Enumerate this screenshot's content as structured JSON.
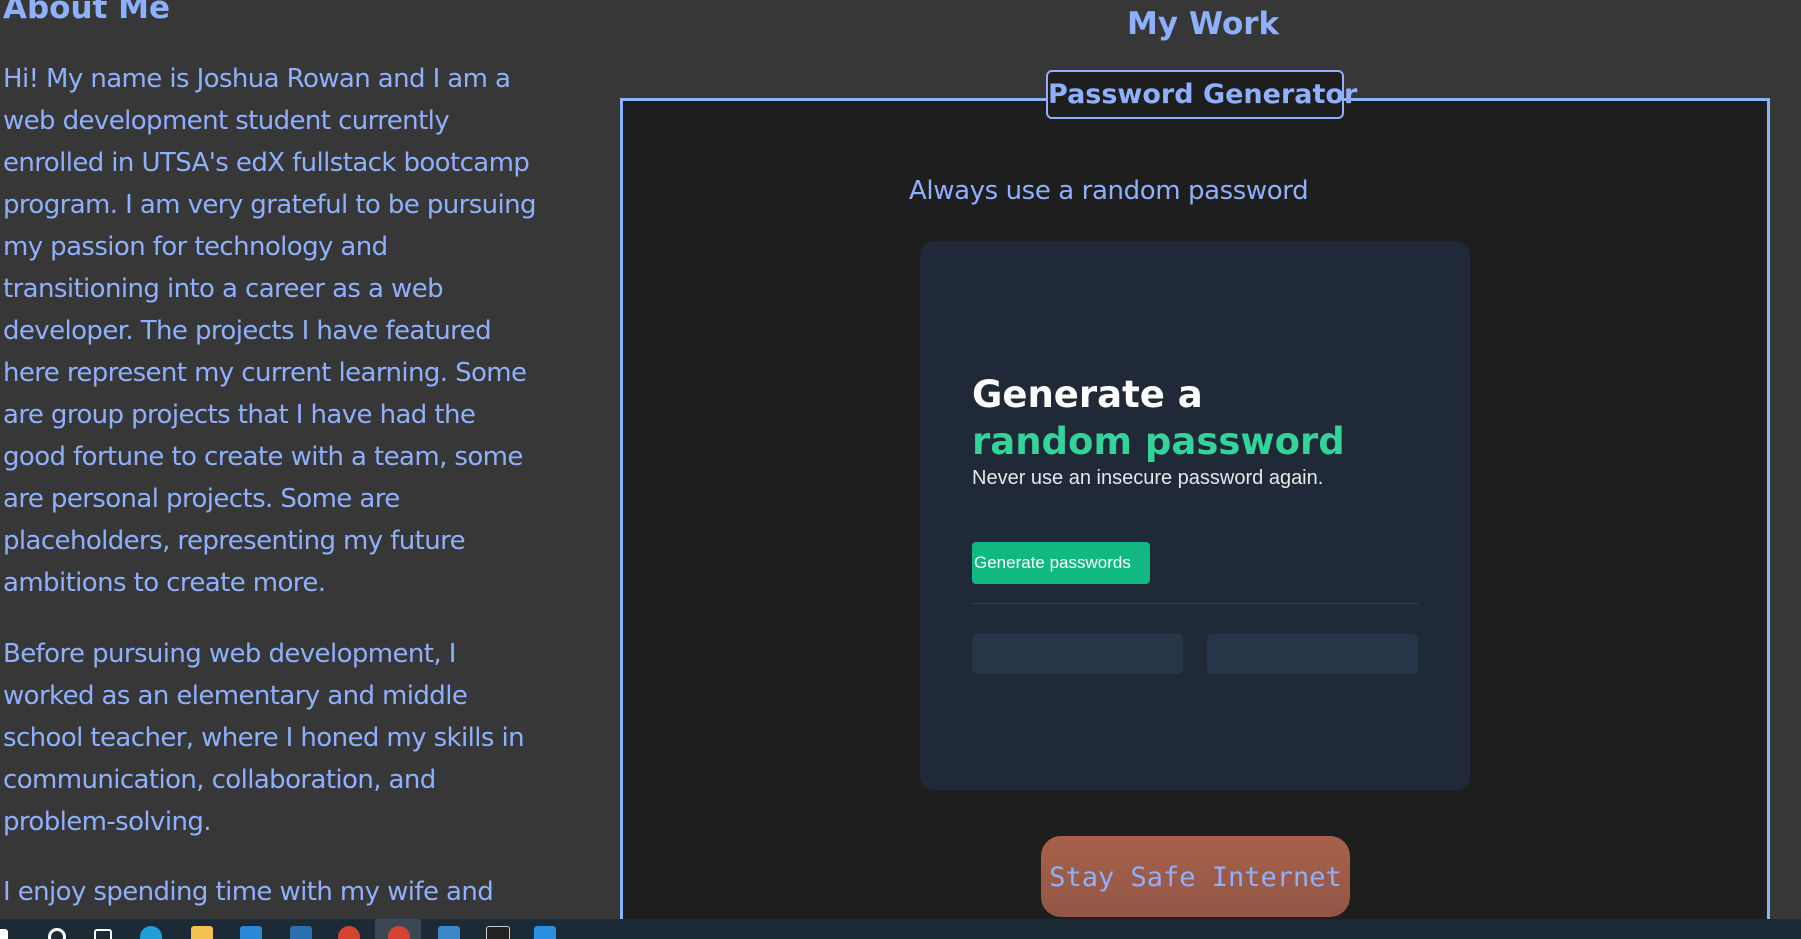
{
  "about": {
    "heading": "About Me",
    "paragraphs": [
      "Hi! My name is Joshua Rowan and I am a web development student currently enrolled in UTSA's edX fullstack bootcamp program. I am very grateful to be pursuing my passion for technology and transitioning into a career as a web developer. The projects I have featured here represent my current learning. Some are group projects that I have had the good fortune to create with a team, some are personal projects. Some are placeholders, representing my future ambitions to create more.",
      "Before pursuing web development, I worked as an elementary and middle school teacher, where I honed my skills in communication, collaboration, and problem-solving.",
      "I enjoy spending time with my wife and"
    ]
  },
  "work": {
    "heading": "My Work",
    "project": {
      "label": "Password Generator",
      "tagline": "Always use a random password",
      "card": {
        "title_line1": "Generate a",
        "title_line2": "random password",
        "subtitle": "Never use an insecure password again.",
        "button_label": "Generate passwords"
      },
      "cta_label": "Stay Safe Internet"
    }
  },
  "colors": {
    "page_bg": "#373737",
    "accent_text": "#8fb0ff",
    "card_bg": "#1f2937",
    "green": "#34d399",
    "button_green": "#10b981",
    "cta_bg": "#a8614a",
    "taskbar_bg": "#1c2a35"
  },
  "taskbar": {
    "icons": [
      "windows-start-icon",
      "search-icon",
      "task-view-icon",
      "edge-icon",
      "file-explorer-icon",
      "store-icon",
      "mail-icon",
      "chrome-icon",
      "chrome-icon",
      "files-icon",
      "terminal-icon",
      "vscode-icon"
    ]
  }
}
